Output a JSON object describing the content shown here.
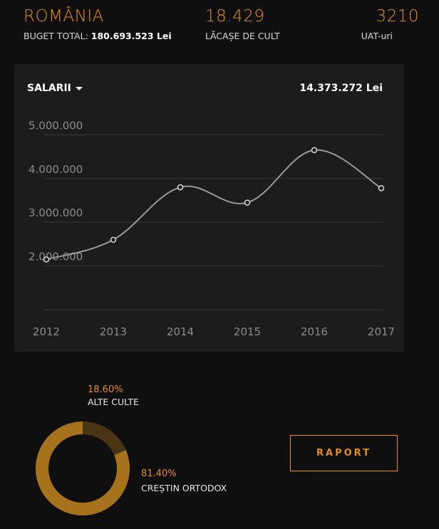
{
  "header": {
    "country": "ROMÂNIA",
    "budget_label": "BUGET TOTAL:",
    "budget_value": "180.693.523 Lei",
    "places_value": "18.429",
    "places_label": "LĂCAȘE DE CULT",
    "uat_value": "3210",
    "uat_label": "UAT-uri"
  },
  "panel": {
    "dropdown_label": "SALARII",
    "total_label": "14.373.272 Lei"
  },
  "chart_data": {
    "type": "line",
    "x": [
      "2012",
      "2013",
      "2014",
      "2015",
      "2016",
      "2017"
    ],
    "series": [
      {
        "values": [
          2150000,
          2600000,
          3800000,
          3450000,
          4650000,
          3780000
        ]
      }
    ],
    "yticks": [
      "5.000.000",
      "4.000.000",
      "3.000.000",
      "2.000.000"
    ],
    "ylim": [
      1000000,
      5250000
    ],
    "grid": true,
    "line_color": "#9a9a9a"
  },
  "donut_data": {
    "type": "pie",
    "slices": [
      {
        "pct": "18.60%",
        "label": "ALTE CULTE",
        "value": 18.6,
        "color": "#4a3414"
      },
      {
        "pct": "81.40%",
        "label": "CREȘTIN ORTODOX",
        "value": 81.4,
        "color": "#a6731c"
      }
    ]
  },
  "actions": {
    "report_button": "RAPORT"
  },
  "colors": {
    "accent": "#e58e1a",
    "background": "#0f0f0f",
    "panel": "#1c1c1c"
  }
}
